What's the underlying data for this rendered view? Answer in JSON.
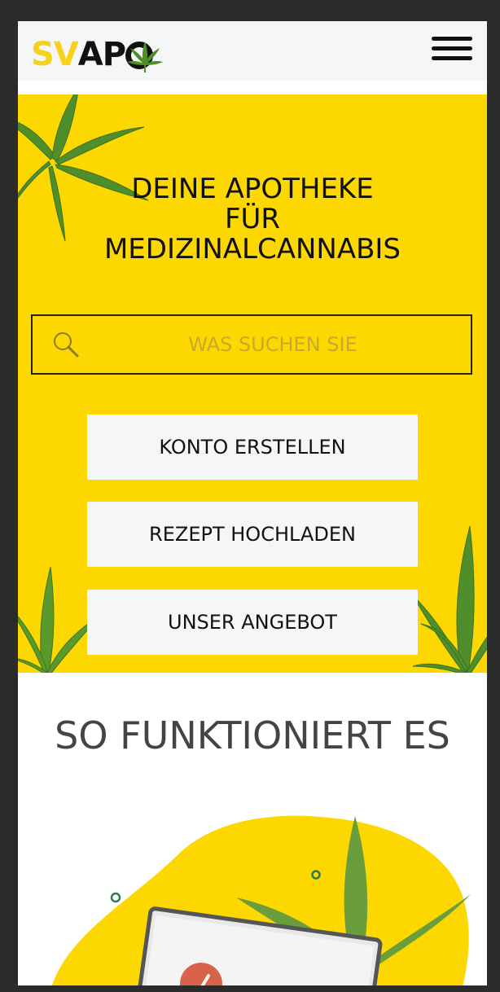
{
  "header": {
    "logo_sv": "SV",
    "logo_ap": "AP",
    "menu_icon": "hamburger-menu-icon"
  },
  "hero": {
    "title_lines": [
      "DEINE APOTHEKE",
      "FÜR",
      "MEDIZINALCANNABIS"
    ],
    "search": {
      "placeholder": "WAS SUCHEN SIE",
      "icon": "search-icon"
    },
    "buttons": {
      "konto": "KONTO ERSTELLEN",
      "rezept": "REZEPT HOCHLADEN",
      "angebot": "UNSER ANGEBOT"
    }
  },
  "how": {
    "title": "SO FUNKTIONIERT ES"
  },
  "colors": {
    "brand_yellow": "#fdd800",
    "leaf_green": "#5e9a2c",
    "dark": "#111111",
    "light_gray": "#f5f6f8"
  }
}
